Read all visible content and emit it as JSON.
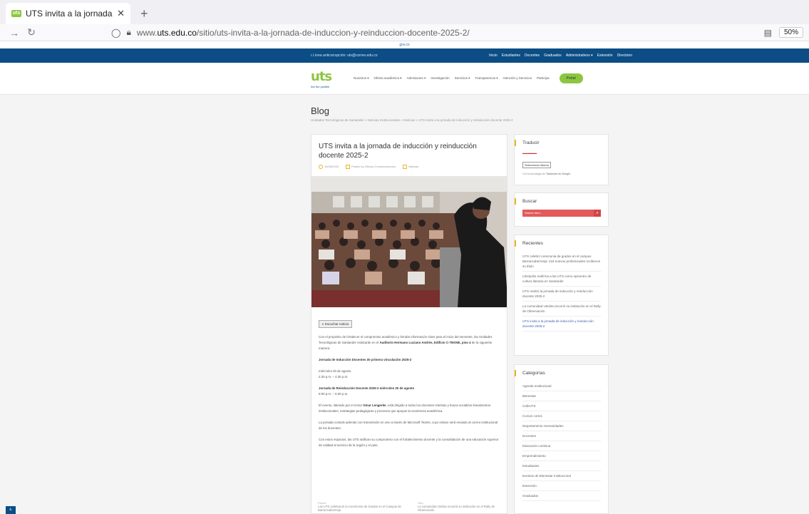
{
  "browser": {
    "tab_title": "UTS invita a la jornada de inducc",
    "tab_favicon": "uts",
    "url_prefix": "www.",
    "url_domain": "uts.edu.co",
    "url_path": "/sitio/uts-invita-a-la-jornada-de-induccion-y-reinduccion-docente-2025-2/",
    "zoom": "50%"
  },
  "site": {
    "gov_strip": "gov.co",
    "contact": "Línea anticorrupción: uts@correo.edu.co",
    "top_links": [
      "Inicio",
      "Estudiantes",
      "Docentes",
      "Graduados",
      "Administrativos ▾",
      "Extensión",
      "Directorio"
    ],
    "logo_text": "uts",
    "logo_tagline": "Así fue posible",
    "nav": [
      "Nosotros ▾",
      "Oferta académica ▾",
      "Admisiones ▾",
      "Investigación",
      "Servicios ▾",
      "Transparencia ▾",
      "Atención y Servicios",
      "Participa"
    ],
    "portal_button": "Portal"
  },
  "page": {
    "blog_title": "Blog",
    "breadcrumb": "Unidades Tecnológicas de Santander » Noticias Institucionales » Noticias » UTS invita a la jornada de inducción y reinducción docente 2025-2"
  },
  "article": {
    "title": "UTS invita a la jornada de inducción y reinducción docente 2025-2",
    "date": "15/08/2025",
    "author": "Posted by Oficina Comunicaciones",
    "category": "Noticias",
    "listen_button": "Escuchar noticia",
    "intro": "Con el propósito de fortalecer el compromiso académico y brindar información clave para el inicio del semestre, las Unidades Tecnológicas de Santander realizarán en el",
    "intro_place": "Auditorio Hermano Luciano Andrés, Edificio C-TEKNE, piso 4",
    "intro_tail": "de la siguiente manera:",
    "section1_title": "Jornada de Inducción Docentes de primera vinculación 2025-2",
    "section1_date": "miércoles 20 de agosto",
    "section1_time": "2:30 p.m. – 4:30 p.m.",
    "section2_title": "Jornada de Reinducción Docente 2025-2 miércoles 20 de agosto",
    "section2_time": "5:00 p.m. – 6:30 p.m.",
    "para1_a": "El evento, liderado por el rector",
    "para1_rector": "Omar Lengerke",
    "para1_b": ", está dirigido a todos los docentes Uteístas y busca socializar lineamientos institucionales, estrategias pedagógicas y procesos que apoyan la excelencia académica.",
    "para2": "La jornada contará además con transmisión en vivo a través de Microsoft Teams, cuyo enlace será enviado al correo institucional de los docentes.",
    "para3": "Con estos espacios, las UTS ratifican su compromiso con el fortalecimiento docente y la consolidación de una educación superior de calidad al servicio de la región y el país."
  },
  "post_nav": {
    "prev_label": "Previo",
    "prev_title": "Las UTS celebraron la Ceremonia de Grados en el Campus de Barrancabermeja",
    "next_label": "Otro",
    "next_title": "La comunidad Uteísta recorrió su institución en el Rally de Observación"
  },
  "sidebar": {
    "translate_title": "Traducir",
    "select_language": "Seleccionar idioma",
    "google_note_a": "Con la tecnología de",
    "google_note_b": "Traductor de Google",
    "search_title": "Buscar",
    "search_placeholder": "Search here..",
    "recent_title": "Recientes",
    "recent": [
      "UTS celebró ceremonia de grados en el campus Barrancabermeja: 218 nuevos profesionales recibieron su título",
      "Librópolis reafirma a las UTS como epicentro de cultura literaria en Santander",
      "UTS realizó la jornada de inducción y reinducción docente 2025-2",
      "La comunidad Uteísta recorrió su institución en el Rally de Observación",
      "UTS invita a la jornada de inducción y reinducción docente 2025-2"
    ],
    "categories_title": "Categorías",
    "categories": [
      "Agenda Institucional",
      "Bienestar",
      "CafeUTS",
      "Cursos cortos",
      "Departamento Humanidades",
      "Docentes",
      "Educación continua",
      "Emprendimiento",
      "Estudiantes",
      "Eventos de Bienestar Institucional",
      "Extensión",
      "Graduados"
    ]
  },
  "colors": {
    "brand_blue": "#0b4d84",
    "brand_green": "#8cc63f",
    "accent_yellow": "#e6b422",
    "search_red": "#e25a5a"
  }
}
